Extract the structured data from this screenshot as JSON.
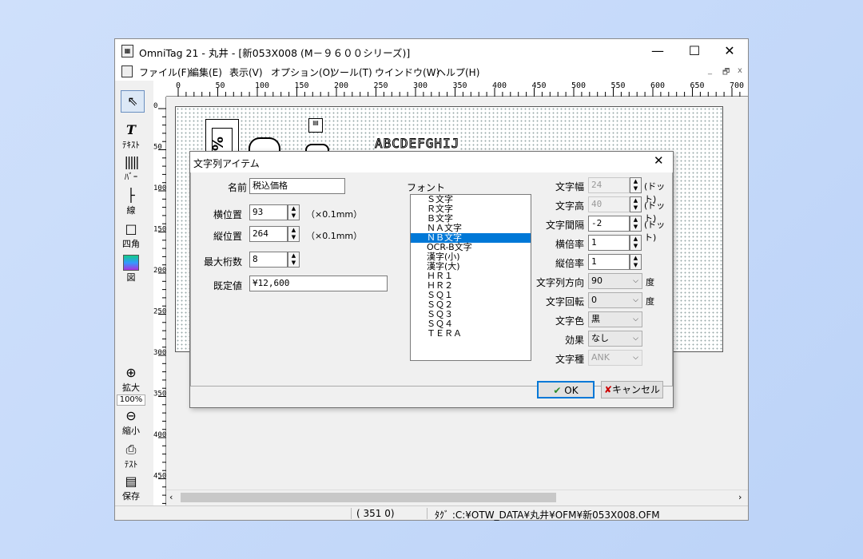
{
  "window": {
    "title": "OmniTag 21 - 丸井 - [新053X008 (M－９６００シリーズ)]",
    "minimize": "—",
    "maximize": "☐",
    "close": "✕"
  },
  "menu": {
    "items": [
      "ファイル(F)",
      "編集(E)",
      "表示(V)",
      "オプション(O)",
      "ツール(T)",
      "ウインドウ(W)",
      "ヘルプ(H)"
    ],
    "mdi_controls": [
      "_",
      "🗗",
      "x"
    ]
  },
  "ruler": {
    "h": [
      "0",
      "50",
      "100",
      "150",
      "200",
      "250",
      "300",
      "350",
      "400",
      "450",
      "500",
      "550",
      "600",
      "650",
      "700"
    ],
    "v": [
      "0",
      "50",
      "100",
      "150",
      "200",
      "250",
      "300",
      "350",
      "400",
      "450"
    ]
  },
  "toolbox": {
    "text_label": "ﾃｷｽﾄ",
    "bar_label": "ﾊﾞｰ",
    "line_label": "線",
    "rect_label": "四角",
    "image_label": "図",
    "zoom_in_label": "拡大",
    "zoom_level": "100%",
    "zoom_out_label": "縮小",
    "test_label": "ﾃｽﾄ",
    "save_label": "保存"
  },
  "canvas": {
    "sample_text": "ABCDEFGHIJ"
  },
  "status": {
    "coords": "( 351    0)",
    "path": "ﾀｸﾞ :C:¥OTW_DATA¥丸井¥OFM¥新053X008.OFM"
  },
  "dialog": {
    "title": "文字列アイテム",
    "close": "✕",
    "name_label": "名前",
    "name_value": "税込価格",
    "xpos_label": "横位置",
    "xpos_value": "93",
    "ypos_label": "縦位置",
    "ypos_value": "264",
    "pos_unit": "（×0.1mm）",
    "maxdigits_label": "最大桁数",
    "maxdigits_value": "8",
    "default_label": "既定値",
    "default_value": "¥12,600",
    "font_label": "フォント",
    "fonts": [
      "Ｓ文字",
      "Ｒ文字",
      "Ｂ文字",
      "ＮＡ文字",
      "ＮＢ文字",
      "OCR-B文字",
      "漢字(小)",
      "漢字(大)",
      "ＨＲ１",
      "ＨＲ２",
      "ＳＱ１",
      "ＳＱ２",
      "ＳＱ３",
      "ＳＱ４",
      "ＴＥＲＡ"
    ],
    "selected_font_index": 4,
    "char_width_label": "文字幅",
    "char_width_value": "24",
    "char_height_label": "文字高",
    "char_height_value": "40",
    "char_spacing_label": "文字間隔",
    "char_spacing_value": "-2",
    "dot_unit": "(ドット)",
    "hscale_label": "横倍率",
    "hscale_value": "1",
    "vscale_label": "縦倍率",
    "vscale_value": "1",
    "direction_label": "文字列方向",
    "direction_value": "90",
    "rotation_label": "文字回転",
    "rotation_value": "0",
    "degree_unit": "度",
    "color_label": "文字色",
    "color_value": "黒",
    "effect_label": "効果",
    "effect_value": "なし",
    "chartype_label": "文字種",
    "chartype_value": "ANK",
    "ok_label": "OK",
    "cancel_label": "キャンセル"
  }
}
